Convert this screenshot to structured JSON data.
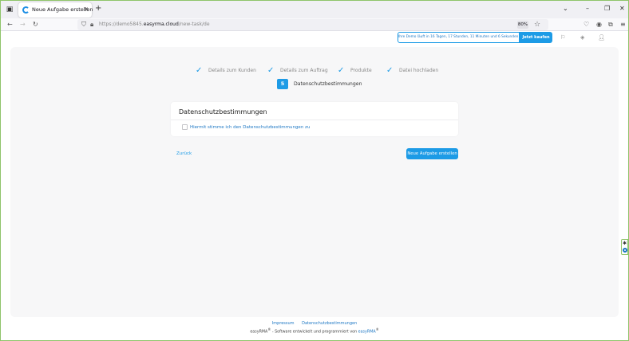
{
  "browser": {
    "tab_title": "Neue Aufgabe erstellen",
    "url_prefix": "https://demo5845.",
    "url_domain": "easyrma.cloud",
    "url_path": "/new-task/de",
    "zoom": "80%"
  },
  "header": {
    "demo_notice": "Ihre Demo läuft in 16 Tagen, 17 Stunden, 11 Minuten und 6 Sekunden ab",
    "buy_label": "Jetzt kaufen"
  },
  "steps": [
    {
      "label": "Details zum Kunden"
    },
    {
      "label": "Details zum Auftrag"
    },
    {
      "label": "Produkte"
    },
    {
      "label": "Datei hochladen"
    }
  ],
  "current_step": {
    "number": "5",
    "label": "Datenschutzbestimmungen"
  },
  "card": {
    "title": "Datenschutzbestimmungen",
    "consent_label": "Hiermit stimme ich den Datenschutzbestimmungen zu"
  },
  "actions": {
    "back_label": "Zurück",
    "submit_label": "Neue Aufgabe erstellen"
  },
  "footer": {
    "imprint": "Impressum",
    "privacy": "Datenschutzbestimmungen",
    "credit_brand": "easyRMA",
    "credit_middle": " - Software entwickelt und programmiert von ",
    "credit_link": "easyRMA",
    "reg_mark": "®"
  },
  "colors": {
    "accent": "#1d9be6",
    "link": "#1d77c4",
    "panel": "#f7f7f8"
  }
}
